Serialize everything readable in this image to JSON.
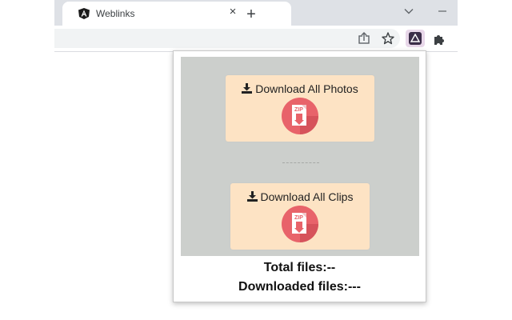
{
  "browser": {
    "tab_title": "Weblinks",
    "tab_close": "×",
    "new_tab": "+"
  },
  "popup": {
    "download_photos_label": "Download All Photos",
    "download_clips_label": "Download All Clips",
    "total_files_label": "Total files:",
    "total_files_value": "--",
    "downloaded_files_label": "Downloaded files:",
    "downloaded_files_value": "---"
  },
  "colors": {
    "panel_bg": "#cccfcc",
    "card_bg": "#fde3c4",
    "zip_circle": "#e8636a"
  },
  "icons": [
    "angular-icon",
    "close-icon",
    "plus-icon",
    "chevron-down-icon",
    "minimize-icon",
    "share-icon",
    "star-icon",
    "extension-icon",
    "puzzle-icon",
    "download-icon",
    "zip-file-icon"
  ]
}
